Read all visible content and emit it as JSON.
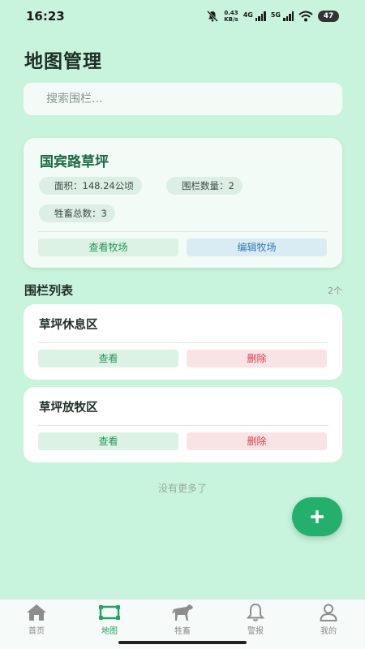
{
  "status_bar": {
    "time": "16:23",
    "net_speed_value": "0.43",
    "net_speed_unit": "KB/s",
    "signal1_label": "4G",
    "signal2_label": "5G",
    "battery": "47"
  },
  "page": {
    "title": "地图管理"
  },
  "search": {
    "placeholder": "搜索围栏..."
  },
  "farm": {
    "name": "国宾路草坪",
    "area": "面积：148.24公顷",
    "fence_count": "围栏数量：2",
    "livestock_total": "牲畜总数：3",
    "view_label": "查看牧场",
    "edit_label": "编辑牧场"
  },
  "fence_list": {
    "title": "围栏列表",
    "count": "2个",
    "items": [
      {
        "name": "草坪休息区",
        "view_label": "查看",
        "delete_label": "删除"
      },
      {
        "name": "草坪放牧区",
        "view_label": "查看",
        "delete_label": "删除"
      }
    ],
    "no_more": "没有更多了"
  },
  "fab": {
    "icon": "plus-icon"
  },
  "tabbar": {
    "items": [
      {
        "label": "首页",
        "icon": "home-icon",
        "active": false
      },
      {
        "label": "地图",
        "icon": "map-icon",
        "active": true
      },
      {
        "label": "牲畜",
        "icon": "horse-icon",
        "active": false
      },
      {
        "label": "警报",
        "icon": "bell-icon",
        "active": false
      },
      {
        "label": "我的",
        "icon": "user-icon",
        "active": false
      }
    ]
  },
  "colors": {
    "background": "#c8f3dc",
    "accent_green": "#23b06d",
    "farm_name": "#1c6a45",
    "delete_red": "#d6404a",
    "edit_blue": "#3279b8"
  }
}
